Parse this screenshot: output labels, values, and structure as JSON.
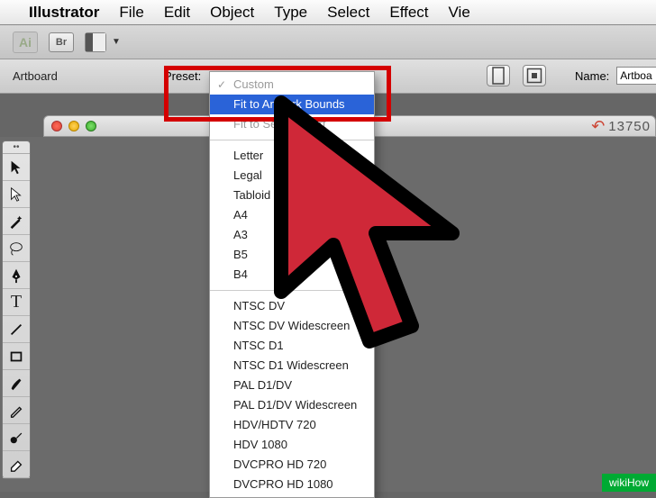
{
  "menubar": {
    "apple": "",
    "appname": "Illustrator",
    "items": [
      "File",
      "Edit",
      "Object",
      "Type",
      "Select",
      "Effect",
      "Vie"
    ]
  },
  "toolbar1": {
    "ai": "Ai",
    "br": "Br"
  },
  "toolbar2": {
    "tool_label": "Artboard",
    "preset_label": "Preset:",
    "name_label": "Name:",
    "name_value": "Artboa"
  },
  "dropdown": {
    "group1": [
      {
        "label": "Custom",
        "disabled": true,
        "checked": true,
        "selected": false
      },
      {
        "label": "Fit to Artwork Bounds",
        "disabled": false,
        "checked": false,
        "selected": true
      },
      {
        "label": "Fit to Selected Art",
        "disabled": true,
        "checked": false,
        "selected": false
      }
    ],
    "group2": [
      "Letter",
      "Legal",
      "Tabloid",
      "A4",
      "A3",
      "B5",
      "B4"
    ],
    "group3": [
      "NTSC DV",
      "NTSC DV Widescreen",
      "NTSC D1",
      "NTSC D1 Widescreen",
      "PAL D1/DV",
      "PAL D1/DV Widescreen",
      "HDV/HDTV 720",
      "HDV 1080",
      "DVCPRO HD 720",
      "DVCPRO HD 1080"
    ]
  },
  "doc": {
    "zoom": "13750"
  },
  "watermark": "wikiHow",
  "tools": [
    "selection",
    "direct-selection",
    "wand",
    "lasso",
    "pen",
    "type",
    "line",
    "rect",
    "brush",
    "pencil",
    "blob",
    "eraser"
  ]
}
